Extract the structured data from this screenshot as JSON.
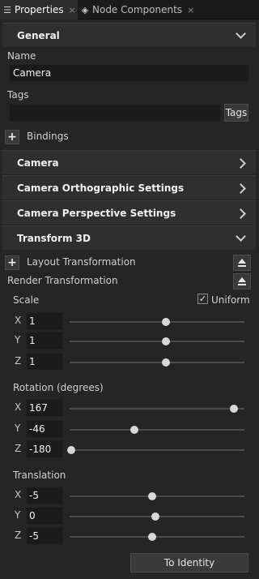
{
  "tabs": [
    {
      "label": "Properties",
      "icon": "list-icon",
      "close": "×"
    },
    {
      "label": "Node Components",
      "icon": "components-icon",
      "close": "×"
    }
  ],
  "sections": {
    "general": "General",
    "camera": "Camera",
    "ortho": "Camera Orthographic Settings",
    "persp": "Camera Perspective Settings",
    "transform": "Transform 3D"
  },
  "general": {
    "name_label": "Name",
    "name_value": "Camera",
    "tags_label": "Tags",
    "tags_value": "",
    "tags_button": "Tags",
    "bindings_label": "Bindings",
    "plus": "+"
  },
  "transform": {
    "layout_label": "Layout Transformation",
    "render_label": "Render Transformation",
    "scale_label": "Scale",
    "uniform_label": "Uniform",
    "uniform_checked": true,
    "check_mark": "✓",
    "rotation_label": "Rotation (degrees)",
    "translation_label": "Translation",
    "identity_button": "To Identity",
    "scale": [
      {
        "axis": "X",
        "value": "1",
        "slider": 0.55
      },
      {
        "axis": "Y",
        "value": "1",
        "slider": 0.55
      },
      {
        "axis": "Z",
        "value": "1",
        "slider": 0.55
      }
    ],
    "rotation": [
      {
        "axis": "X",
        "value": "167",
        "slider": 0.94
      },
      {
        "axis": "Y",
        "value": "-46",
        "slider": 0.37
      },
      {
        "axis": "Z",
        "value": "-180",
        "slider": 0.01
      }
    ],
    "translation": [
      {
        "axis": "X",
        "value": "-5",
        "slider": 0.47
      },
      {
        "axis": "Y",
        "value": "0",
        "slider": 0.49
      },
      {
        "axis": "Z",
        "value": "-5",
        "slider": 0.47
      }
    ]
  }
}
